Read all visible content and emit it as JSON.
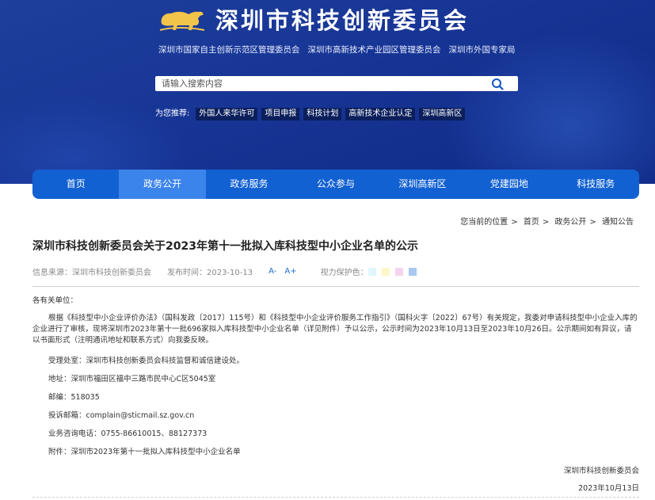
{
  "header": {
    "site_title": "深圳市科技创新委员会",
    "sub_links": [
      "深圳市国家自主创新示范区管理委员会",
      "深圳市高新技术产业园区管理委员会",
      "深圳市外国专家局"
    ],
    "search": {
      "placeholder": "请输入搜索内容"
    },
    "hot_label": "为您推荐:",
    "hot_tags": [
      "外国人来华许可",
      "项目申报",
      "科技计划",
      "高新技术企业认定",
      "深圳高新区"
    ]
  },
  "nav": {
    "items": [
      "首页",
      "政务公开",
      "政务服务",
      "公众参与",
      "深圳高新区",
      "党建园地",
      "科技服务"
    ],
    "active": "政务公开"
  },
  "breadcrumb": {
    "prefix": "您当前的位置",
    "items": [
      "首页",
      "政务公开",
      "通知公告"
    ],
    "sep": ">"
  },
  "article": {
    "title": "深圳市科技创新委员会关于2023年第十一批拟入库科技型中小企业名单的公示",
    "source_label": "信息来源：深圳市科技创新委员会",
    "date_label": "发布时间：2023-10-13",
    "font_smaller": "A-",
    "font_larger": "A+",
    "eye_label": "视力保护色：",
    "eye_colors": [
      "#dff5fb",
      "#fbf7c9",
      "#f5d3ef",
      "#a9c8ef"
    ],
    "salutation": "各有关单位：",
    "main_paragraph": "根据《科技型中小企业评价办法》（国科发政〔2017〕115号）和《科技型中小企业评价服务工作指引》（国科火字〔2022〕67号）有关规定，我委对申请科技型中小企业入库的企业进行了审核，现将深圳市2023年第十一批696家拟入库科技型中小企业名单（详见附件）予以公示，公示时间为2023年10月13日至2023年10月26日。公示期间如有异议，请以书面形式（注明通讯地址和联系方式）向我委反映。",
    "contact_items": [
      "受理处室：深圳市科技创新委员会科技监督和诚信建设处。",
      "地址：深圳市福田区福中三路市民中心C区5045室",
      "邮编：518035",
      "投诉邮箱：complain@sticmail.sz.gov.cn",
      "业务咨询电话：0755-86610015、88127373",
      "附件：深圳市2023年第十一批拟入库科技型中小企业名单"
    ],
    "signature": "深圳市科技创新委员会",
    "sign_date": "2023年10月13日"
  }
}
